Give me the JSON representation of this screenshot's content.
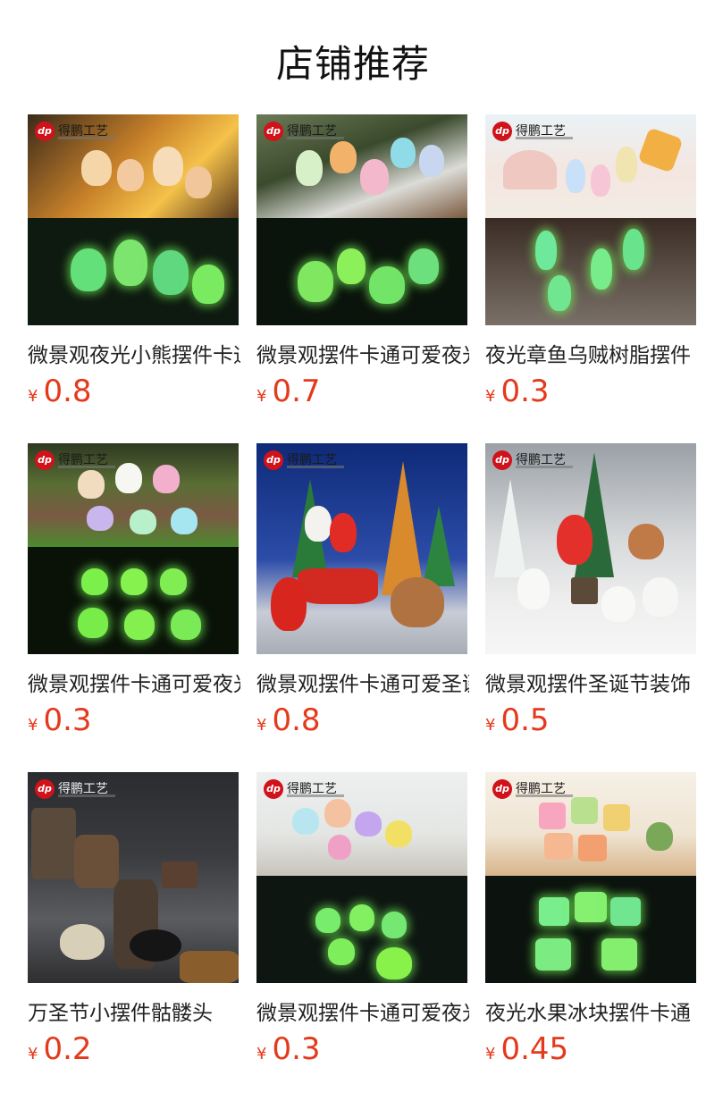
{
  "page": {
    "title": "店铺推荐"
  },
  "brand": {
    "logo_text": "得鹏工艺",
    "logo_mark": "dp"
  },
  "products": [
    {
      "name": "微景观夜光小熊摆件卡通可爱",
      "currency": "¥",
      "price": "0.8",
      "image": "glow-bear-figurines"
    },
    {
      "name": "微景观摆件卡通可爱夜光恐龙",
      "currency": "¥",
      "price": "0.7",
      "image": "glow-dinosaur-figurines"
    },
    {
      "name": "夜光章鱼乌贼树脂摆件",
      "currency": "¥",
      "price": "0.3",
      "image": "glow-squid-figurines"
    },
    {
      "name": "微景观摆件卡通可爱夜光幽灵",
      "currency": "¥",
      "price": "0.3",
      "image": "glow-ghost-figurines"
    },
    {
      "name": "微景观摆件卡通可爱圣诞老人",
      "currency": "¥",
      "price": "0.8",
      "image": "christmas-sleigh-scene"
    },
    {
      "name": "微景观摆件圣诞节装饰",
      "currency": "¥",
      "price": "0.5",
      "image": "christmas-snowman-scene"
    },
    {
      "name": "万圣节小摆件骷髅头",
      "currency": "¥",
      "price": "0.2",
      "image": "halloween-skull-scene"
    },
    {
      "name": "微景观摆件卡通可爱夜光鸭子",
      "currency": "¥",
      "price": "0.3",
      "image": "glow-duck-figurines"
    },
    {
      "name": "夜光水果冰块摆件卡通",
      "currency": "¥",
      "price": "0.45",
      "image": "glow-fruit-ice-cubes"
    }
  ]
}
